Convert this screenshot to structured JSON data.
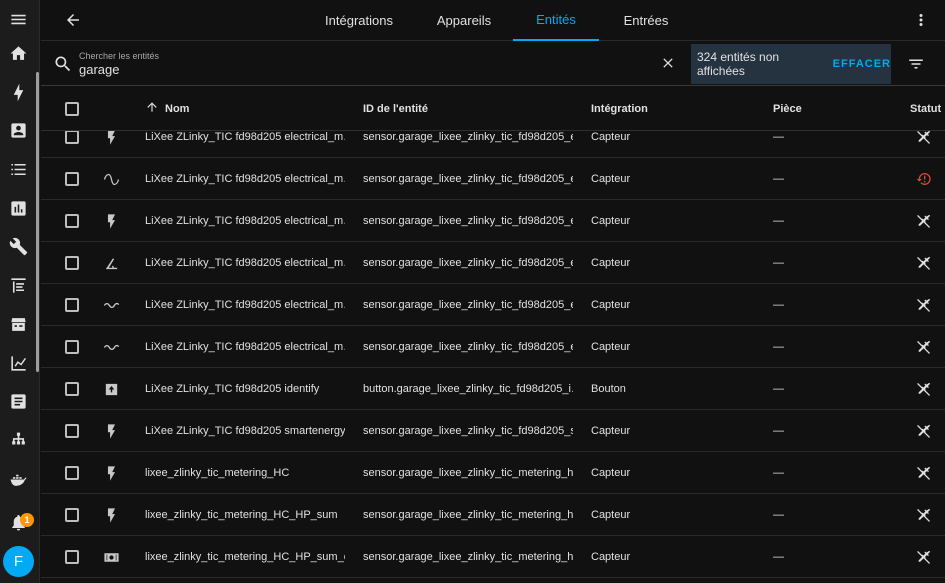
{
  "tabs": [
    {
      "label": "Intégrations",
      "active": false
    },
    {
      "label": "Appareils",
      "active": false
    },
    {
      "label": "Entités",
      "active": true
    },
    {
      "label": "Entrées",
      "active": false
    }
  ],
  "search": {
    "label": "Chercher les entités",
    "value": "garage"
  },
  "hidden_notice": {
    "text": "324 entités non affichées",
    "clear_label": "EFFACER"
  },
  "columns": {
    "name": "Nom",
    "entity_id": "ID de l'entité",
    "integration": "Intégration",
    "room": "Pièce",
    "status": "Statut"
  },
  "sidebar": {
    "notification_count": "1",
    "avatar_initial": "F"
  },
  "colors": {
    "accent": "#03a9f4",
    "badge": "#ff9800",
    "error": "#db4437",
    "notice_bg": "#253341"
  },
  "rows": [
    {
      "icon": "flash-icon",
      "name": "LiXee ZLinky_TIC fd98d205 electrical_m…",
      "entity_id": "sensor.garage_lixee_zlinky_tic_fd98d205_e…",
      "integration": "Capteur",
      "room": "—",
      "status": "disabled"
    },
    {
      "icon": "sine-wave-icon",
      "name": "LiXee ZLinky_TIC fd98d205 electrical_m…",
      "entity_id": "sensor.garage_lixee_zlinky_tic_fd98d205_e…",
      "integration": "Capteur",
      "room": "—",
      "status": "unavailable"
    },
    {
      "icon": "flash-icon",
      "name": "LiXee ZLinky_TIC fd98d205 electrical_m…",
      "entity_id": "sensor.garage_lixee_zlinky_tic_fd98d205_e…",
      "integration": "Capteur",
      "room": "—",
      "status": "disabled"
    },
    {
      "icon": "angle-icon",
      "name": "LiXee ZLinky_TIC fd98d205 electrical_m…",
      "entity_id": "sensor.garage_lixee_zlinky_tic_fd98d205_e…",
      "integration": "Capteur",
      "room": "—",
      "status": "disabled"
    },
    {
      "icon": "current-ac-icon",
      "name": "LiXee ZLinky_TIC fd98d205 electrical_m…",
      "entity_id": "sensor.garage_lixee_zlinky_tic_fd98d205_e…",
      "integration": "Capteur",
      "room": "—",
      "status": "disabled"
    },
    {
      "icon": "current-ac-icon",
      "name": "LiXee ZLinky_TIC fd98d205 electrical_m…",
      "entity_id": "sensor.garage_lixee_zlinky_tic_fd98d205_e…",
      "integration": "Capteur",
      "room": "—",
      "status": "disabled"
    },
    {
      "icon": "button-icon",
      "name": "LiXee ZLinky_TIC fd98d205 identify",
      "entity_id": "button.garage_lixee_zlinky_tic_fd98d205_i…",
      "integration": "Bouton",
      "room": "—",
      "status": "disabled"
    },
    {
      "icon": "flash-icon",
      "name": "LiXee ZLinky_TIC fd98d205 smartenergy…",
      "entity_id": "sensor.garage_lixee_zlinky_tic_fd98d205_s…",
      "integration": "Capteur",
      "room": "—",
      "status": "disabled"
    },
    {
      "icon": "flash-icon",
      "name": "lixee_zlinky_tic_metering_HC",
      "entity_id": "sensor.garage_lixee_zlinky_tic_metering_hc",
      "integration": "Capteur",
      "room": "—",
      "status": "disabled"
    },
    {
      "icon": "flash-icon",
      "name": "lixee_zlinky_tic_metering_HC_HP_sum",
      "entity_id": "sensor.garage_lixee_zlinky_tic_metering_h…",
      "integration": "Capteur",
      "room": "—",
      "status": "disabled"
    },
    {
      "icon": "cash-icon",
      "name": "lixee_zlinky_tic_metering_HC_HP_sum_c…",
      "entity_id": "sensor.garage_lixee_zlinky_tic_metering_h…",
      "integration": "Capteur",
      "room": "—",
      "status": "disabled"
    }
  ]
}
